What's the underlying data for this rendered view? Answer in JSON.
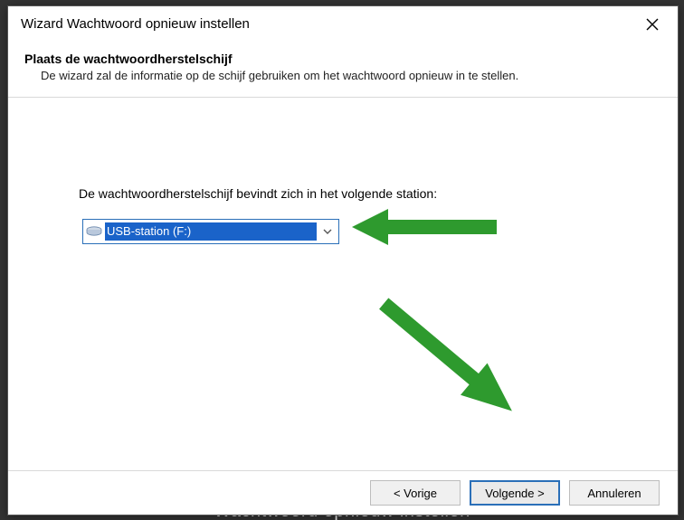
{
  "titlebar": {
    "title": "Wizard Wachtwoord opnieuw instellen"
  },
  "header": {
    "heading": "Plaats de wachtwoordherstelschijf",
    "subtext": "De wizard zal de informatie op de schijf gebruiken om het wachtwoord opnieuw in te stellen."
  },
  "content": {
    "prompt": "De wachtwoordherstelschijf bevindt zich in het volgende station:",
    "drive_select": {
      "selected": "USB-station (F:)",
      "icon_name": "drive-icon"
    }
  },
  "footer": {
    "back": "< Vorige",
    "next": "Volgende >",
    "cancel": "Annuleren"
  },
  "background_hint": "Wachtwoord opnieuw instellen",
  "colors": {
    "selection_bg": "#1a63c9",
    "combo_border": "#2a6fb8",
    "arrow_fill": "#2e9a2e"
  }
}
